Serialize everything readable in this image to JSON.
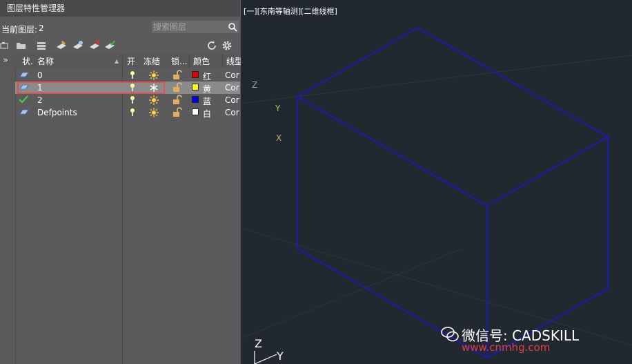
{
  "panel": {
    "title": "图层特性管理器",
    "current_label": "当前图层:",
    "current_value": "2",
    "search_placeholder": "搜索图层"
  },
  "columns": {
    "status": "状.",
    "name": "名称",
    "on": "开",
    "freeze": "冻结",
    "lock": "锁...",
    "color": "颜色",
    "linetype": "线型"
  },
  "layers": [
    {
      "name": "0",
      "color_name": "红",
      "color": "#e00000",
      "linetype": "Cor"
    },
    {
      "name": "1",
      "color_name": "黄",
      "color": "#ffff00",
      "linetype": "Cor"
    },
    {
      "name": "2",
      "color_name": "蓝",
      "color": "#0000e0",
      "linetype": "Cor"
    },
    {
      "name": "Defpoints",
      "color_name": "白",
      "color": "#ffffff",
      "linetype": "Cor"
    }
  ],
  "viewport": {
    "label": "[一][东南等轴测][二维线框]",
    "axis_z": "Z",
    "axis_y": "Y",
    "axis_x": "X",
    "ucs_z": "Z",
    "ucs_y": "Y"
  },
  "watermark": {
    "text": "微信号: CADSKILL",
    "site": "www.cnmhg.com"
  }
}
